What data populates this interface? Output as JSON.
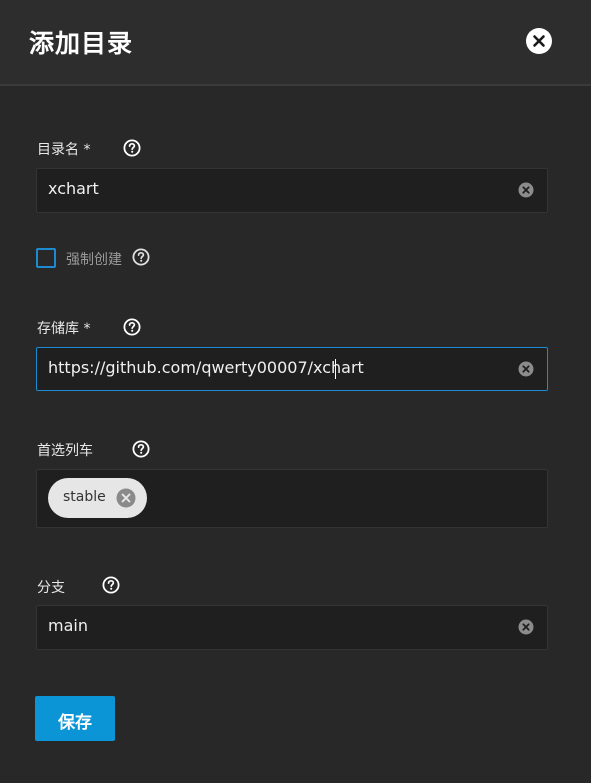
{
  "dialog": {
    "title": "添加目录"
  },
  "form": {
    "catalog_name": {
      "label": "目录名 *",
      "value": "xchart"
    },
    "force_create": {
      "label": "强制创建",
      "checked": false
    },
    "repository": {
      "label": "存储库 *",
      "value": "https://github.com/qwerty00007/xchart"
    },
    "preferred_trains": {
      "label": "首选列车",
      "chips": [
        "stable"
      ]
    },
    "branch": {
      "label": "分支",
      "value": "main"
    }
  },
  "actions": {
    "save_label": "保存"
  },
  "colors": {
    "accent": "#0c95d6",
    "focus_border": "#1b8bd4",
    "background": "#282828"
  },
  "icons": {
    "close": "close-icon",
    "help": "help-circle-icon",
    "clear": "clear-circle-icon",
    "chip_remove": "chip-remove-icon"
  }
}
